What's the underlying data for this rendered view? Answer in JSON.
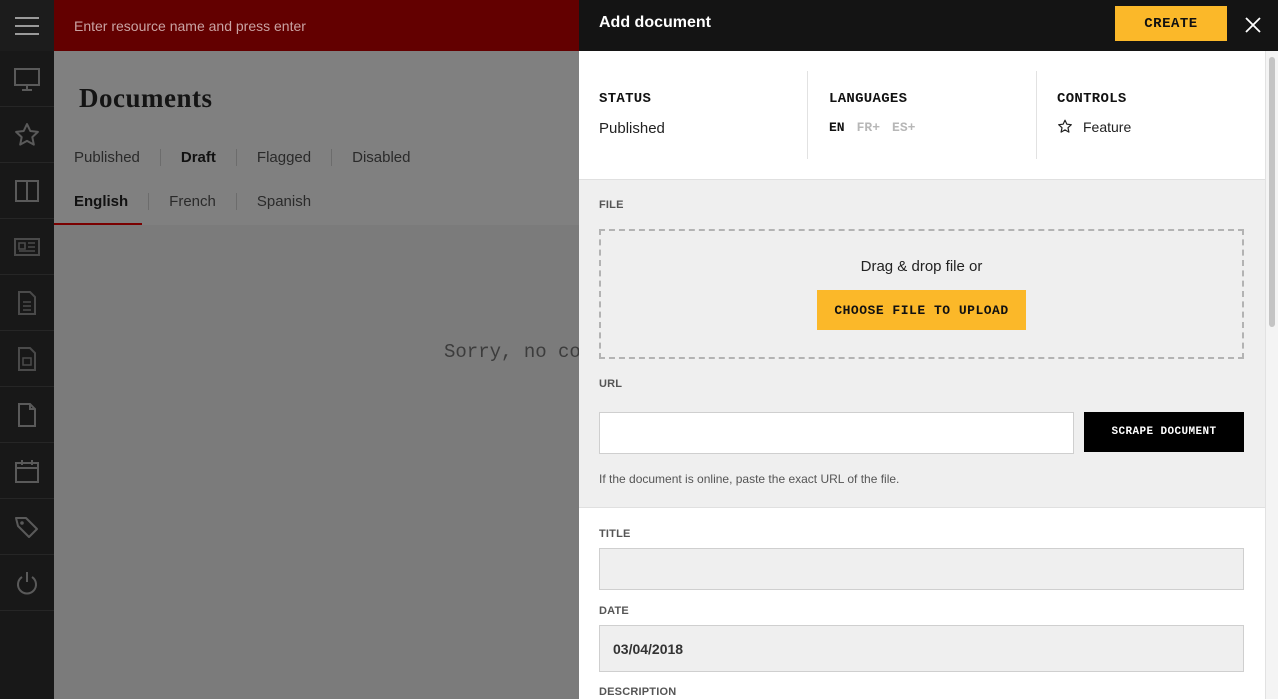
{
  "topbar": {
    "search_placeholder": "Enter resource name and press enter"
  },
  "background_page": {
    "title": "Documents",
    "status_filters": [
      "Published",
      "Draft",
      "Flagged",
      "Disabled"
    ],
    "active_status_filter": "Draft",
    "language_tabs": [
      "English",
      "French",
      "Spanish"
    ],
    "active_language_tab": "English",
    "empty_message": "Sorry, no co"
  },
  "rail": {
    "icons": [
      "menu-icon",
      "monitor-icon",
      "star-icon",
      "columns-icon",
      "newspaper-icon",
      "document-text-icon",
      "document-media-icon",
      "document-icon",
      "calendar-icon",
      "tags-icon",
      "power-icon"
    ]
  },
  "panel": {
    "title": "Add document",
    "create_label": "CREATE",
    "status": {
      "label": "STATUS",
      "value": "Published"
    },
    "languages": {
      "label": "LANGUAGES",
      "items": [
        "EN",
        "FR",
        "ES"
      ],
      "add_symbol": "+"
    },
    "controls": {
      "label": "CONTROLS",
      "feature_label": "Feature"
    },
    "file": {
      "label": "FILE",
      "drop_text": "Drag & drop file or",
      "upload_label": "CHOOSE FILE TO UPLOAD"
    },
    "url": {
      "label": "URL",
      "value": "",
      "scrape_label": "SCRAPE DOCUMENT",
      "help": "If the document is online, paste the exact URL of the file."
    },
    "title_field": {
      "label": "TITLE",
      "value": ""
    },
    "date_field": {
      "label": "DATE",
      "value": "03/04/2018"
    },
    "description_field": {
      "label": "DESCRIPTION"
    }
  },
  "colors": {
    "accent": "#fbb829",
    "topbar": "#630000",
    "panel_header": "#141414",
    "rail": "#181818"
  }
}
